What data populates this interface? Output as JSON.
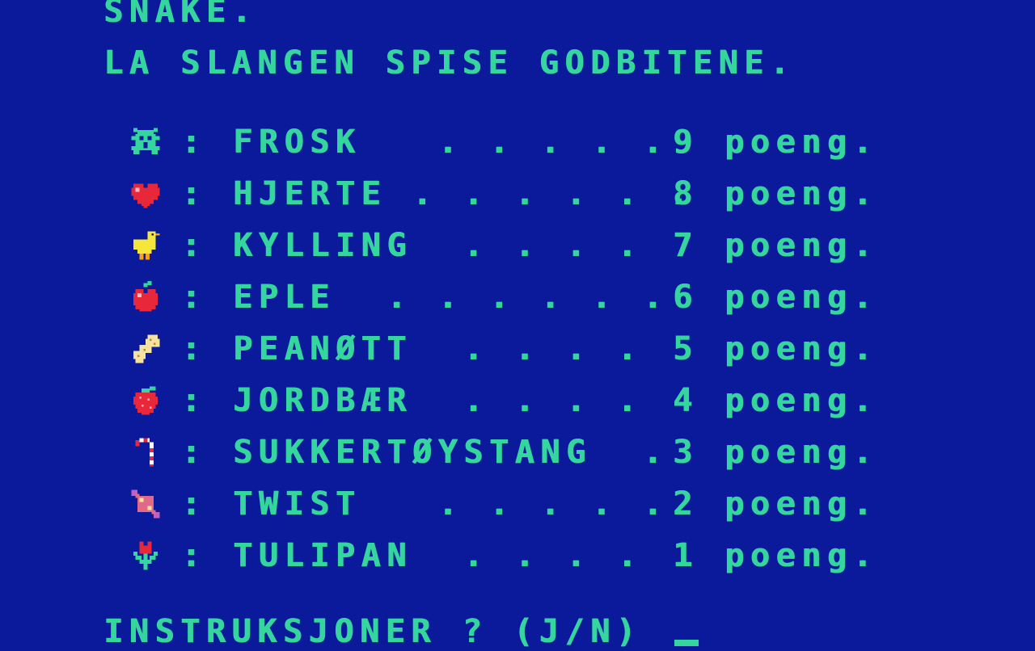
{
  "title": "SNAKE.",
  "subtitle": "LA SLANGEN SPISE GODBITENE.",
  "separator": ":",
  "unit_label": "poeng.",
  "treats": [
    {
      "icon": "frog-icon",
      "name": "FROSK",
      "dots": "        . . . . .",
      "points": "9"
    },
    {
      "icon": "heart-icon",
      "name": "HJERTE",
      "dots": "       . . . . . .",
      "points": "8"
    },
    {
      "icon": "chick-icon",
      "name": "KYLLING",
      "dots": "         . . . .",
      "points": "7"
    },
    {
      "icon": "apple-icon",
      "name": "EPLE",
      "dots": "      . . . . . .",
      "points": "6"
    },
    {
      "icon": "peanut-icon",
      "name": "PEANØTT",
      "dots": "         . . . .",
      "points": "5"
    },
    {
      "icon": "strawberry-icon",
      "name": "JORDBÆR",
      "dots": "         . . . .",
      "points": "4"
    },
    {
      "icon": "candy-cane-icon",
      "name": "SUKKERTØYSTANG",
      "dots": "                .",
      "points": "3"
    },
    {
      "icon": "wrapped-candy-icon",
      "name": "TWIST",
      "dots": "        . . . . .",
      "points": "2"
    },
    {
      "icon": "tulip-icon",
      "name": "TULIPAN",
      "dots": "         . . . .",
      "points": "1"
    }
  ],
  "prompt": "INSTRUKSJONER ? (J/N)",
  "colors": {
    "background": "#0A1A9A",
    "text": "#35D59E"
  }
}
